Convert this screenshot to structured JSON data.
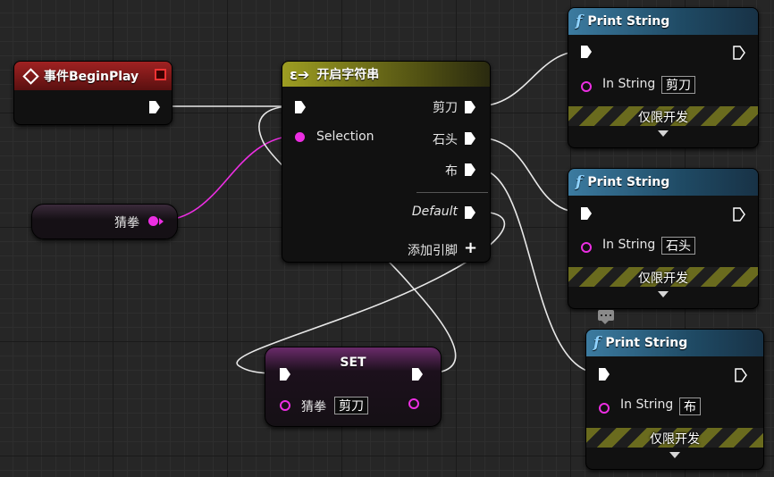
{
  "begin_play": {
    "title": "事件BeginPlay"
  },
  "switch": {
    "title": "开启字符串",
    "selection_label": "Selection",
    "outputs": [
      "剪刀",
      "石头",
      "布"
    ],
    "default_label": "Default",
    "add_pin_label": "添加引脚"
  },
  "variable": {
    "label": "猜拳"
  },
  "set_node": {
    "title": "SET",
    "var_label": "猜拳",
    "value": "剪刀"
  },
  "print_nodes": [
    {
      "title": "Print String",
      "in_label": "In String",
      "value": "剪刀",
      "dev_label": "仅限开发"
    },
    {
      "title": "Print String",
      "in_label": "In String",
      "value": "石头",
      "dev_label": "仅限开发"
    },
    {
      "title": "Print String",
      "in_label": "In String",
      "value": "布",
      "dev_label": "仅限开发"
    }
  ],
  "colors": {
    "event_header": "#8e1b1b",
    "switch_header": "#8a8a1a",
    "function_header": "#3b6e8f",
    "set_header": "#8a3c8a",
    "string_pin": "#ec2ee2",
    "exec_wire": "#ffffff"
  },
  "icons": [
    "event-diamond-icon",
    "switch-icon",
    "function-icon",
    "exec-pin-icon",
    "string-pin-icon",
    "add-pin-icon",
    "comment-bubble-icon",
    "chevron-down-icon"
  ]
}
